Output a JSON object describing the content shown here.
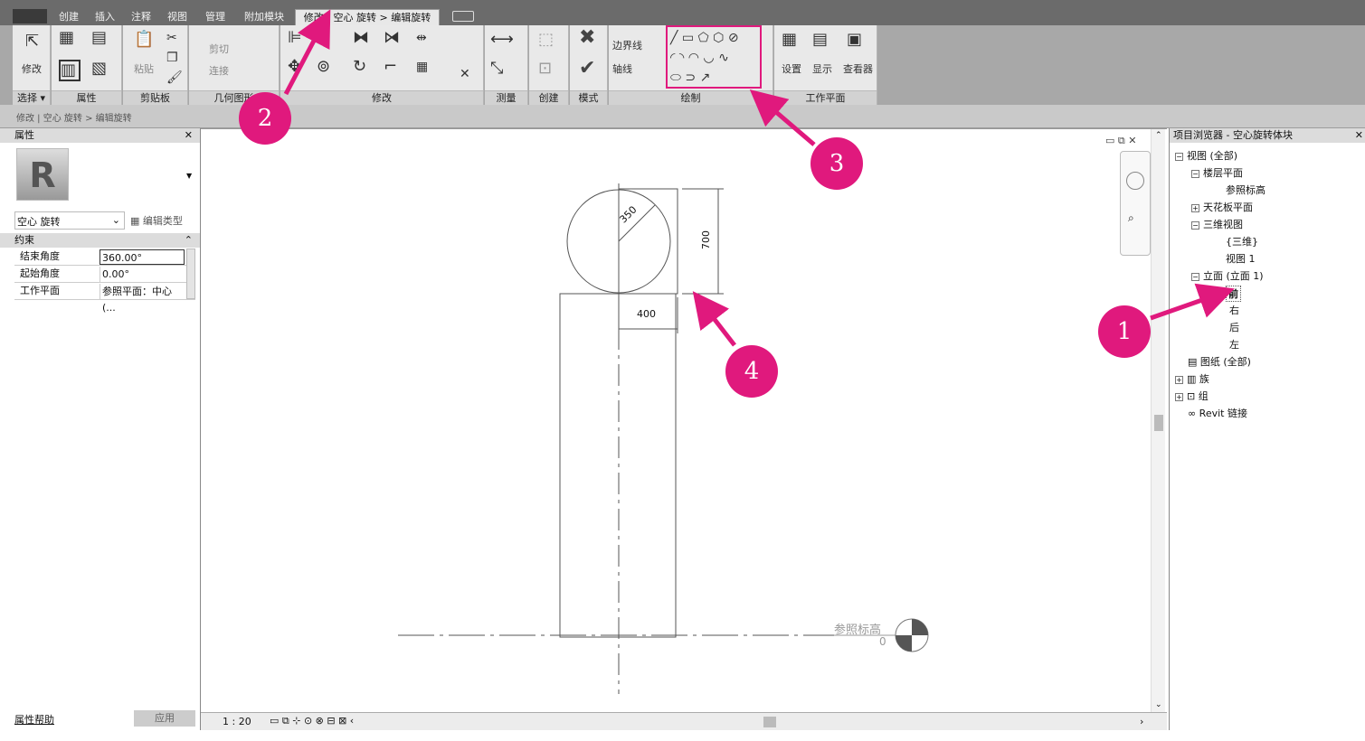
{
  "tabs": [
    "创建",
    "插入",
    "注释",
    "视图",
    "管理",
    "附加模块",
    "修改 | 空心 旋转 > 编辑旋转"
  ],
  "ribbon": {
    "modify_label": "修改",
    "panels": {
      "select": "选择 ▾",
      "properties": "属性",
      "clipboard": "剪贴板",
      "geometry": "几何图形",
      "modify": "修改",
      "measure": "测量",
      "create": "创建",
      "mode": "模式",
      "draw": "绘制",
      "workplane": "工作平面"
    },
    "paste": "粘贴",
    "cut": "剪切",
    "join": "连接",
    "boundary_line": "边界线",
    "axis_line": "轴线",
    "set": "设置",
    "show": "显示",
    "viewer": "查看器"
  },
  "breadcrumb": "修改 | 空心 旋转 > 编辑旋转",
  "properties": {
    "header": "属性",
    "type_selector": "空心 旋转",
    "edit_type": "编辑类型",
    "group": "约束",
    "rows": [
      {
        "key": "结束角度",
        "value": "360.00°"
      },
      {
        "key": "起始角度",
        "value": "0.00°"
      },
      {
        "key": "工作平面",
        "value": "参照平面：中心(..."
      }
    ],
    "help": "属性帮助",
    "apply": "应用"
  },
  "canvas": {
    "dim_radius": "350",
    "dim_height": "700",
    "dim_width": "400",
    "level_name": "参照标高",
    "level_value": "0"
  },
  "status": {
    "scale": "1 : 20"
  },
  "browser": {
    "title": "项目浏览器 - 空心旋转体块",
    "items": [
      "视图 (全部)",
      "楼层平面",
      "参照标高",
      "天花板平面",
      "三维视图",
      "{三维}",
      "视图 1",
      "立面 (立面 1)",
      "前",
      "右",
      "后",
      "左",
      "图纸 (全部)",
      "族",
      "组",
      "Revit 链接"
    ]
  },
  "callouts": [
    "1",
    "2",
    "3",
    "4"
  ],
  "colors": {
    "accent": "#e0197d"
  }
}
